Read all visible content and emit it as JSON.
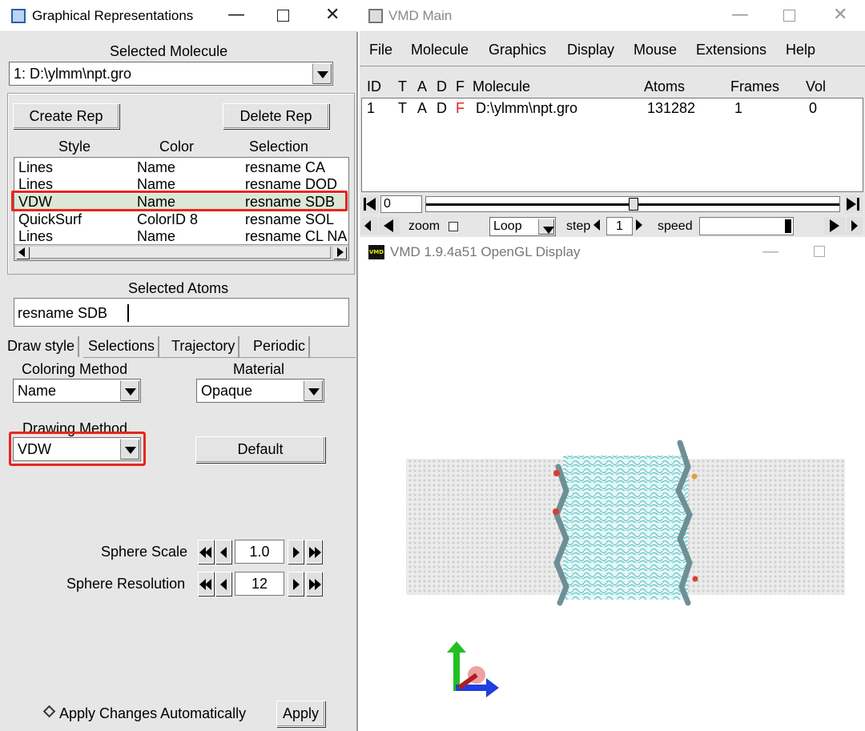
{
  "graphical_reps": {
    "title": "Graphical Representations",
    "selected_molecule_label": "Selected Molecule",
    "selected_molecule_value": "1: D:\\ylmm\\npt.gro",
    "create_rep_label": "Create Rep",
    "delete_rep_label": "Delete Rep",
    "columns": [
      "Style",
      "Color",
      "Selection"
    ],
    "reps": [
      {
        "style": "Lines",
        "color": "Name",
        "selection": "resname CA"
      },
      {
        "style": "Lines",
        "color": "Name",
        "selection": "resname DOD"
      },
      {
        "style": "VDW",
        "color": "Name",
        "selection": "resname SDB"
      },
      {
        "style": "QuickSurf",
        "color": "ColorID 8",
        "selection": "resname SOL"
      },
      {
        "style": "Lines",
        "color": "Name",
        "selection": "resname CL NA"
      }
    ],
    "selected_atoms_label": "Selected Atoms",
    "selected_atoms_value": "resname SDB",
    "tabs": [
      "Draw style",
      "Selections",
      "Trajectory",
      "Periodic"
    ],
    "coloring_method_label": "Coloring Method",
    "coloring_method_value": "Name",
    "material_label": "Material",
    "material_value": "Opaque",
    "drawing_method_label": "Drawing Method",
    "drawing_method_value": "VDW",
    "default_label": "Default",
    "sphere_scale_label": "Sphere Scale",
    "sphere_scale_value": "1.0",
    "sphere_resolution_label": "Sphere Resolution",
    "sphere_resolution_value": "12",
    "apply_auto_label": "Apply Changes Automatically",
    "apply_label": "Apply",
    "highlight_color": "#e8261f"
  },
  "vmd_main": {
    "title": "VMD Main",
    "menu": [
      "File",
      "Molecule",
      "Graphics",
      "Display",
      "Mouse",
      "Extensions",
      "Help"
    ],
    "headers": {
      "id": "ID",
      "t": "T",
      "a": "A",
      "d": "D",
      "f": "F",
      "molecule": "Molecule",
      "atoms": "Atoms",
      "frames": "Frames",
      "vol": "Vol"
    },
    "row": {
      "id": "1",
      "t": "T",
      "a": "A",
      "d": "D",
      "f": "F",
      "molecule": "D:\\ylmm\\npt.gro",
      "atoms": "131282",
      "frames": "1",
      "vol": "0"
    },
    "frame_value": "0",
    "zoom_label": "zoom",
    "loop_value": "Loop",
    "step_label": "step",
    "step_value": "1",
    "speed_label": "speed"
  },
  "opengl": {
    "title": "VMD 1.9.4a51 OpenGL Display",
    "icon_text": "VMD"
  },
  "colors": {
    "water": "#dcdcdc",
    "lipid": "#5cc8c8",
    "axis_x": "#1f3fe0",
    "axis_y": "#22c022",
    "axis_z": "#e04040"
  }
}
